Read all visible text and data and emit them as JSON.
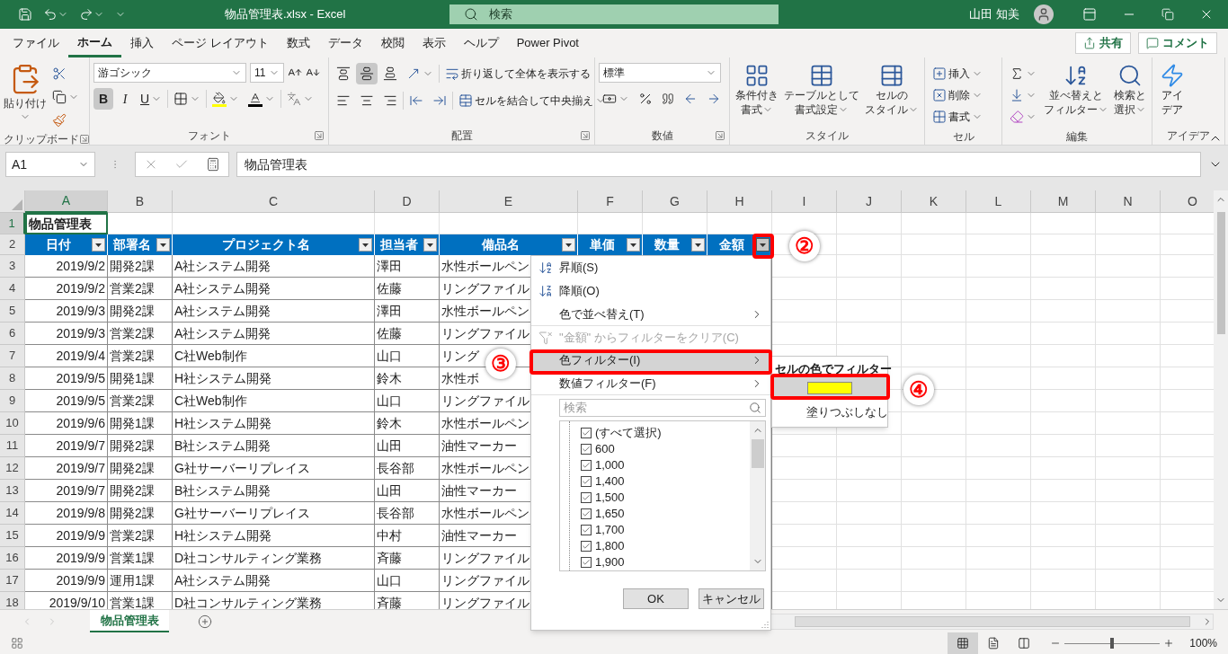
{
  "title_bar": {
    "title": "物品管理表.xlsx - Excel",
    "search_placeholder": "検索",
    "user_name": "山田 知美"
  },
  "ribbon_tabs": [
    {
      "label": "ファイル",
      "selected": false
    },
    {
      "label": "ホーム",
      "selected": true
    },
    {
      "label": "挿入",
      "selected": false
    },
    {
      "label": "ページ レイアウト",
      "selected": false
    },
    {
      "label": "数式",
      "selected": false
    },
    {
      "label": "データ",
      "selected": false
    },
    {
      "label": "校閲",
      "selected": false
    },
    {
      "label": "表示",
      "selected": false
    },
    {
      "label": "ヘルプ",
      "selected": false
    },
    {
      "label": "Power Pivot",
      "selected": false
    }
  ],
  "share_button": "共有",
  "comment_button": "コメント",
  "ribbon": {
    "clipboard": {
      "label": "クリップボード",
      "paste": "貼り付け"
    },
    "font": {
      "label": "フォント",
      "font_name": "游ゴシック",
      "font_size": "11",
      "bold": "B",
      "italic": "I",
      "underline": "U",
      "bold_active": true
    },
    "alignment": {
      "label": "配置",
      "wrap": "折り返して全体を表示する",
      "merge": "セルを結合して中央揃え",
      "middle_active": true
    },
    "number": {
      "label": "数値",
      "format": "標準"
    },
    "styles": {
      "label": "スタイル",
      "buttons": [
        {
          "lines": [
            "条件付き",
            "書式"
          ]
        },
        {
          "lines": [
            "テーブルとして",
            "書式設定"
          ]
        },
        {
          "lines": [
            "セルの",
            "スタイル"
          ]
        }
      ]
    },
    "cells": {
      "label": "セル",
      "buttons": [
        "挿入",
        "削除",
        "書式"
      ]
    },
    "editing": {
      "label": "編集",
      "buttons": [
        {
          "lines": [
            "並べ替えと",
            "フィルター"
          ]
        },
        {
          "lines": [
            "検索と",
            "選択"
          ]
        }
      ]
    },
    "ideas": {
      "label": "アイデア",
      "button": {
        "lines": [
          "アイ",
          "デア"
        ]
      }
    }
  },
  "formula_bar": {
    "name_box": "A1",
    "formula": "物品管理表"
  },
  "sheet": {
    "columns": [
      {
        "label": "A",
        "selected": true
      },
      {
        "label": "B",
        "selected": false
      },
      {
        "label": "C",
        "selected": false
      },
      {
        "label": "D",
        "selected": false
      },
      {
        "label": "E",
        "selected": false
      },
      {
        "label": "F",
        "selected": false
      },
      {
        "label": "G",
        "selected": false
      },
      {
        "label": "H",
        "selected": false
      },
      {
        "label": "I",
        "selected": false
      },
      {
        "label": "J",
        "selected": false
      },
      {
        "label": "K",
        "selected": false
      },
      {
        "label": "L",
        "selected": false
      },
      {
        "label": "M",
        "selected": false
      },
      {
        "label": "N",
        "selected": false
      },
      {
        "label": "O",
        "selected": false
      }
    ],
    "row_numbers": [
      {
        "label": "1",
        "selected": true
      },
      {
        "label": "2",
        "selected": false
      },
      {
        "label": "3",
        "selected": false
      },
      {
        "label": "4",
        "selected": false
      },
      {
        "label": "5",
        "selected": false
      },
      {
        "label": "6",
        "selected": false
      },
      {
        "label": "7",
        "selected": false
      },
      {
        "label": "8",
        "selected": false
      },
      {
        "label": "9",
        "selected": false
      },
      {
        "label": "10",
        "selected": false
      },
      {
        "label": "11",
        "selected": false
      },
      {
        "label": "12",
        "selected": false
      },
      {
        "label": "13",
        "selected": false
      },
      {
        "label": "14",
        "selected": false
      },
      {
        "label": "15",
        "selected": false
      },
      {
        "label": "16",
        "selected": false
      },
      {
        "label": "17",
        "selected": false
      },
      {
        "label": "18",
        "selected": false
      }
    ],
    "title": "物品管理表",
    "headers": [
      {
        "label": "日付",
        "open": false
      },
      {
        "label": "部署名",
        "open": false
      },
      {
        "label": "プロジェクト名",
        "open": false
      },
      {
        "label": "担当者",
        "open": false
      },
      {
        "label": "備品名",
        "open": false
      },
      {
        "label": "単価",
        "open": false
      },
      {
        "label": "数量",
        "open": false
      },
      {
        "label": "金額",
        "open": true
      }
    ],
    "rows": [
      [
        "2019/9/2",
        "開発2課",
        "A社システム開発",
        "澤田",
        "水性ボールペン"
      ],
      [
        "2019/9/2",
        "営業2課",
        "A社システム開発",
        "佐藤",
        "リングファイル"
      ],
      [
        "2019/9/3",
        "開発2課",
        "A社システム開発",
        "澤田",
        "水性ボールペン"
      ],
      [
        "2019/9/3",
        "営業2課",
        "A社システム開発",
        "佐藤",
        "リングファイル"
      ],
      [
        "2019/9/4",
        "営業2課",
        "C社Web制作",
        "山口",
        "リング"
      ],
      [
        "2019/9/5",
        "開発1課",
        "H社システム開発",
        "鈴木",
        "水性ボ"
      ],
      [
        "2019/9/5",
        "営業2課",
        "C社Web制作",
        "山口",
        "リングファイル"
      ],
      [
        "2019/9/6",
        "開発1課",
        "H社システム開発",
        "鈴木",
        "水性ボールペン"
      ],
      [
        "2019/9/7",
        "開発2課",
        "B社システム開発",
        "山田",
        "油性マーカー"
      ],
      [
        "2019/9/7",
        "開発2課",
        "G社サーバーリプレイス",
        "長谷部",
        "水性ボールペン"
      ],
      [
        "2019/9/7",
        "開発2課",
        "B社システム開発",
        "山田",
        "油性マーカー"
      ],
      [
        "2019/9/8",
        "開発2課",
        "G社サーバーリプレイス",
        "長谷部",
        "水性ボールペン"
      ],
      [
        "2019/9/9",
        "営業2課",
        "H社システム開発",
        "中村",
        "油性マーカー"
      ],
      [
        "2019/9/9",
        "営業1課",
        "D社コンサルティング業務",
        "斉藤",
        "リングファイル"
      ],
      [
        "2019/9/9",
        "運用1課",
        "A社システム開発",
        "山口",
        "リングファイル"
      ],
      [
        "2019/9/10",
        "営業1課",
        "D社コンサルティング業務",
        "斉藤",
        "リングファイル"
      ]
    ]
  },
  "filter_menu": {
    "items": [
      {
        "kind": "sort_asc",
        "label": "昇順(S)",
        "disabled": false,
        "selected": false,
        "submenu": false,
        "divider_after": false
      },
      {
        "kind": "sort_desc",
        "label": "降順(O)",
        "disabled": false,
        "selected": false,
        "submenu": false,
        "divider_after": false
      },
      {
        "kind": "plain",
        "label": "色で並べ替え(T)",
        "disabled": false,
        "selected": false,
        "submenu": true,
        "divider_after": true
      },
      {
        "kind": "clear",
        "label": "\"金額\" からフィルターをクリア(C)",
        "disabled": true,
        "selected": false,
        "submenu": false,
        "divider_after": false
      },
      {
        "kind": "plain",
        "label": "色フィルター(I)",
        "disabled": false,
        "selected": true,
        "submenu": true,
        "divider_after": false
      },
      {
        "kind": "plain",
        "label": "数値フィルター(F)",
        "disabled": false,
        "selected": false,
        "submenu": true,
        "divider_after": true
      }
    ],
    "search_placeholder": "検索",
    "values": [
      {
        "label": "(すべて選択)",
        "checked": true
      },
      {
        "label": "600",
        "checked": true
      },
      {
        "label": "1,000",
        "checked": true
      },
      {
        "label": "1,400",
        "checked": true
      },
      {
        "label": "1,500",
        "checked": true
      },
      {
        "label": "1,650",
        "checked": true
      },
      {
        "label": "1,700",
        "checked": true
      },
      {
        "label": "1,800",
        "checked": true
      },
      {
        "label": "1,900",
        "checked": true
      }
    ],
    "ok": "OK",
    "cancel": "キャンセル"
  },
  "filter_submenu": {
    "title": "セルの色でフィルター",
    "swatch": {
      "color": "#ffff00",
      "selected": true
    },
    "none_label": "塗りつぶしなし"
  },
  "annotations": [
    {
      "label": "②"
    },
    {
      "label": "③"
    },
    {
      "label": "④"
    }
  ],
  "sheet_tabs": [
    {
      "label": "物品管理表",
      "selected": true
    }
  ],
  "status_bar": {
    "views": [
      {
        "kind": "normal",
        "selected": true
      },
      {
        "kind": "page_layout",
        "selected": false
      },
      {
        "kind": "page_break",
        "selected": false
      }
    ],
    "zoom": {
      "level": 0.5,
      "reading": "100%"
    }
  }
}
